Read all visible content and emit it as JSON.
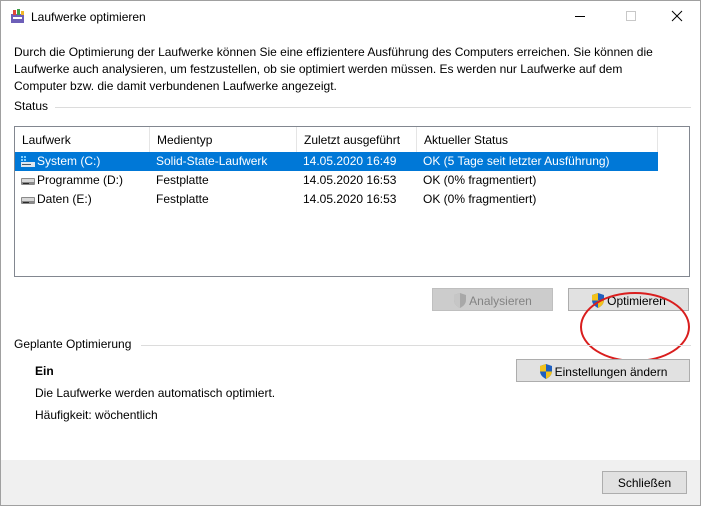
{
  "window": {
    "title": "Laufwerke optimieren",
    "controls": {
      "minimize": "minimize-icon",
      "maximize": "maximize-icon",
      "close": "close-icon"
    }
  },
  "intro": "Durch die Optimierung der Laufwerke können Sie eine effizientere Ausführung des Computers erreichen. Sie können die Laufwerke auch analysieren, um festzustellen, ob sie optimiert werden müssen. Es werden nur Laufwerke auf dem Computer bzw. die damit verbundenen Laufwerke angezeigt.",
  "status": {
    "label": "Status",
    "columns": [
      "Laufwerk",
      "Medientyp",
      "Zuletzt ausgeführt",
      "Aktueller Status"
    ],
    "rows": [
      {
        "drive": "System (C:)",
        "media": "Solid-State-Laufwerk",
        "last_run": "14.05.2020 16:49",
        "status": "OK (5 Tage seit letzter Ausführung)",
        "icon": "system-drive-icon",
        "selected": true
      },
      {
        "drive": "Programme (D:)",
        "media": "Festplatte",
        "last_run": "14.05.2020 16:53",
        "status": "OK (0% fragmentiert)",
        "icon": "hard-drive-icon",
        "selected": false
      },
      {
        "drive": "Daten (E:)",
        "media": "Festplatte",
        "last_run": "14.05.2020 16:53",
        "status": "OK (0% fragmentiert)",
        "icon": "hard-drive-icon",
        "selected": false
      }
    ],
    "analyze_button": "Analysieren",
    "optimize_button": "Optimieren"
  },
  "scheduled": {
    "label": "Geplante Optimierung",
    "state": "Ein",
    "description": "Die Laufwerke werden automatisch optimiert.",
    "frequency": "Häufigkeit: wöchentlich",
    "change_settings_button": "Einstellungen ändern"
  },
  "footer": {
    "close_button": "Schließen"
  },
  "colors": {
    "selection": "#0078d7",
    "annotation_circle": "#d91e1e",
    "shield_blue": "#1f5fbf",
    "shield_yellow": "#f2c21b"
  }
}
